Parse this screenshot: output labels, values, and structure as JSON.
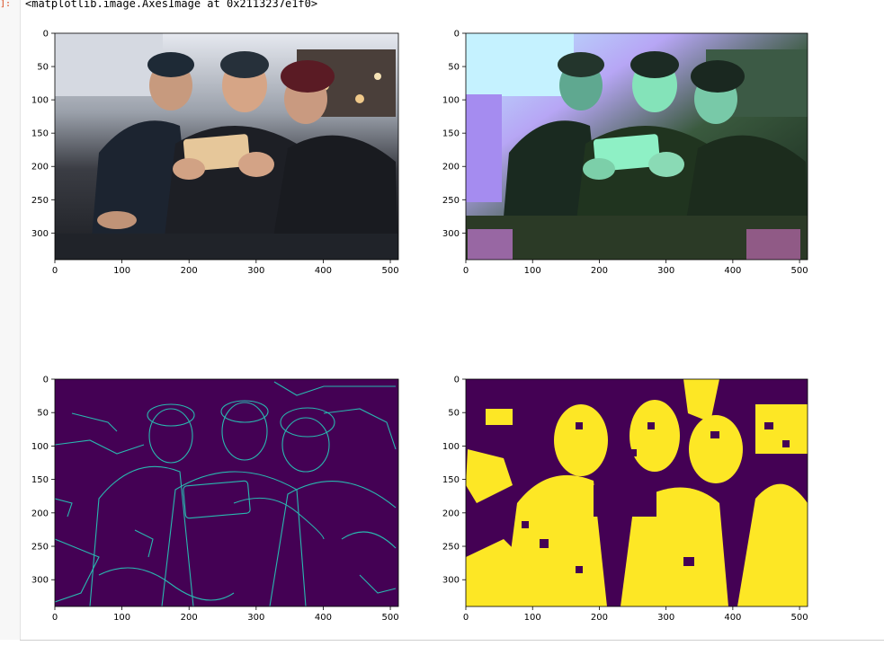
{
  "cell": {
    "prompt_marker": "]:",
    "output_repr": "<matplotlib.image.AxesImage at 0x2113237e1f0>"
  },
  "figure": {
    "subplots": [
      {
        "kind": "photo-original",
        "x_ticks": [
          "0",
          "100",
          "200",
          "300",
          "400",
          "500"
        ],
        "y_ticks": [
          "0",
          "50",
          "100",
          "150",
          "200",
          "250",
          "300"
        ]
      },
      {
        "kind": "photo-color-transformed",
        "x_ticks": [
          "0",
          "100",
          "200",
          "300",
          "400",
          "500"
        ],
        "y_ticks": [
          "0",
          "50",
          "100",
          "150",
          "200",
          "250",
          "300"
        ]
      },
      {
        "kind": "canny-edges",
        "x_ticks": [
          "0",
          "100",
          "200",
          "300",
          "400",
          "500"
        ],
        "y_ticks": [
          "0",
          "50",
          "100",
          "150",
          "200",
          "250",
          "300"
        ]
      },
      {
        "kind": "binary-mask",
        "x_ticks": [
          "0",
          "100",
          "200",
          "300",
          "400",
          "500"
        ],
        "y_ticks": [
          "0",
          "50",
          "100",
          "150",
          "200",
          "250",
          "300"
        ]
      }
    ],
    "colors": {
      "viridis_dark": "#440154",
      "viridis_teal": "#21908d",
      "viridis_yellow": "#fde725"
    },
    "image_extent": {
      "x": [
        0,
        512
      ],
      "y": [
        0,
        340
      ]
    }
  }
}
